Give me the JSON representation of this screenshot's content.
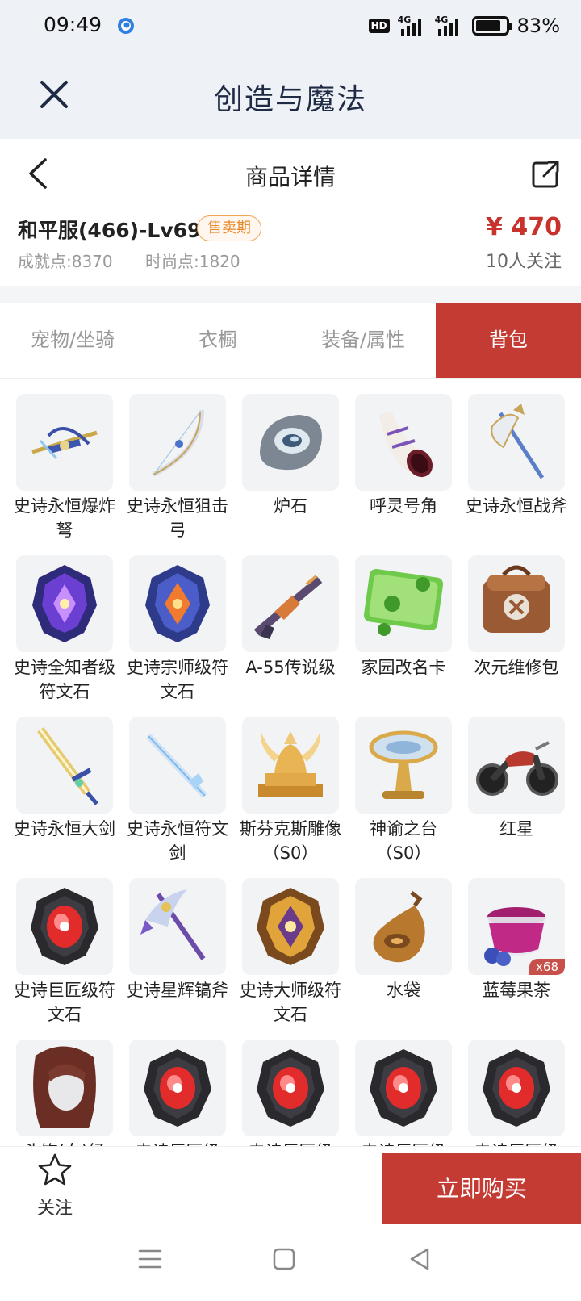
{
  "status_bar": {
    "time": "09:49",
    "hd": "HD",
    "net1": "4G",
    "net2": "4G",
    "battery": "83%",
    "battery_level": 0.83
  },
  "title_bar": {
    "title": "创造与魔法",
    "close_icon": "close-icon"
  },
  "header": {
    "title": "商品详情",
    "back_icon": "chevron-left-icon",
    "share_icon": "share-icon"
  },
  "info": {
    "server": "和平服(466)-Lv69",
    "badge": "售卖期",
    "price": "¥ 470",
    "achievement": "成就点:8370",
    "fashion": "时尚点:1820",
    "followers": "10人关注"
  },
  "tabs": [
    "宠物/坐骑",
    "衣橱",
    "装备/属性",
    "背包"
  ],
  "active_tab": 3,
  "items": [
    {
      "name": "史诗永恒爆炸弩",
      "icon": "crossbow-icon"
    },
    {
      "name": "史诗永恒狙击弓",
      "icon": "bow-icon"
    },
    {
      "name": "炉石",
      "icon": "hearthstone-icon"
    },
    {
      "name": "呼灵号角",
      "icon": "horn-icon"
    },
    {
      "name": "史诗永恒战斧",
      "icon": "battle-axe-icon"
    },
    {
      "name": "史诗全知者级符文石",
      "icon": "purple-rune-icon"
    },
    {
      "name": "史诗宗师级符文石",
      "icon": "orange-rune-icon"
    },
    {
      "name": "A-55传说级",
      "icon": "rifle-icon"
    },
    {
      "name": "家园改名卡",
      "icon": "rename-card-icon"
    },
    {
      "name": "次元维修包",
      "icon": "repair-bag-icon"
    },
    {
      "name": "史诗永恒大剑",
      "icon": "greatsword-icon"
    },
    {
      "name": "史诗永恒符文剑",
      "icon": "rune-sword-icon"
    },
    {
      "name": "斯芬克斯雕像（S0）",
      "icon": "sphinx-statue-icon"
    },
    {
      "name": "神谕之台（S0）",
      "icon": "oracle-stand-icon"
    },
    {
      "name": "红星",
      "icon": "motorcycle-icon"
    },
    {
      "name": "史诗巨匠级符文石",
      "icon": "red-rune-icon"
    },
    {
      "name": "史诗星辉镐斧",
      "icon": "pickaxe-icon"
    },
    {
      "name": "史诗大师级符文石",
      "icon": "gold-rune-icon"
    },
    {
      "name": "水袋",
      "icon": "water-bag-icon"
    },
    {
      "name": "蓝莓果茶",
      "icon": "tea-cup-icon",
      "qty": "x68"
    },
    {
      "name": "头饰(女)经",
      "icon": "hair-icon"
    },
    {
      "name": "史诗巨匠级",
      "icon": "red-rune-icon"
    },
    {
      "name": "史诗巨匠级",
      "icon": "red-rune-icon"
    },
    {
      "name": "史诗巨匠级",
      "icon": "red-rune-icon"
    },
    {
      "name": "史诗巨匠级",
      "icon": "red-rune-icon"
    }
  ],
  "action_bar": {
    "follow_label": "关注",
    "follow_icon": "star-icon",
    "buy_label": "立即购买"
  },
  "nav_bar": {
    "menu_icon": "menu-icon",
    "home_icon": "home-square-icon",
    "back_icon": "back-triangle-icon"
  },
  "colors": {
    "accent": "#c43b34",
    "price": "#c8322d",
    "badge": "#e98a2b",
    "title_bg": "#eef2f7"
  }
}
